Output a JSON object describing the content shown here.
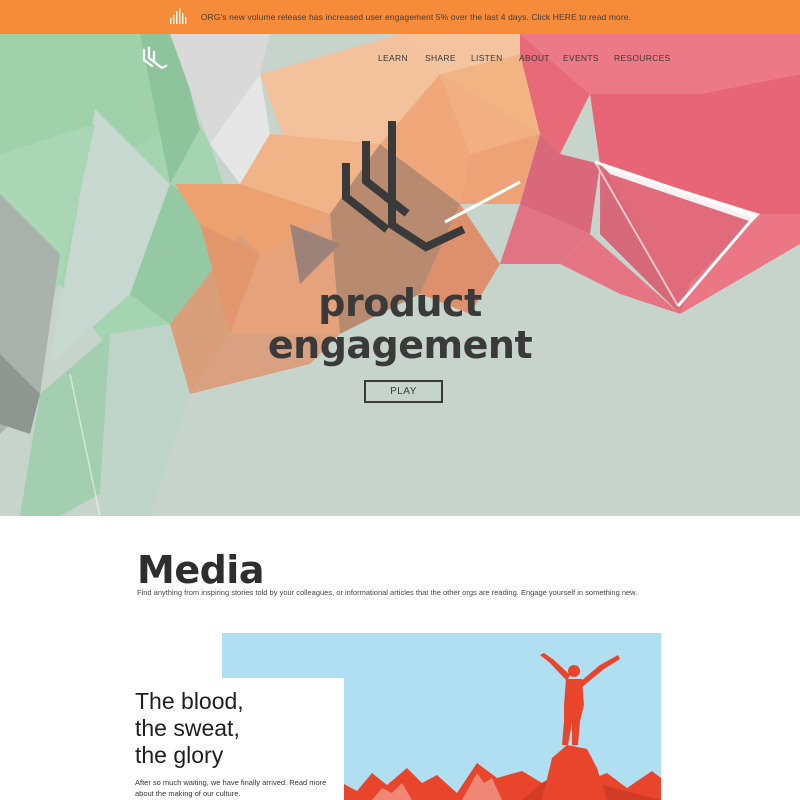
{
  "announcement": {
    "icon": "bar-chart-icon",
    "text": "ORG's new volume release has increased user engagement 5% over the last 4 days. Click HERE to read more."
  },
  "nav": {
    "logo": "brand-logo-icon",
    "items": [
      "LEARN",
      "SHARE",
      "LISTEN",
      "ABOUT",
      "EVENTS",
      "RESOURCES"
    ]
  },
  "hero": {
    "title_line1": "product",
    "title_line2": "engagement",
    "play_label": "PLAY"
  },
  "media": {
    "heading": "Media",
    "description": "Find anything from inspiring stories told by your colleagues, or informational articles that the other orgs are reading. Engage yourself in something new.",
    "feature": {
      "title_line1": "The blood,",
      "title_line2": "the sweat,",
      "title_line3": "the glory",
      "text": "After so much waiting, we have finally arrived. Read more about the making of our culture."
    }
  },
  "colors": {
    "announcement_bg": "#f68c3a",
    "hero_bg": "#c7d4cc",
    "feature_sky": "#b1dff2",
    "feature_figure": "#e8452c"
  }
}
